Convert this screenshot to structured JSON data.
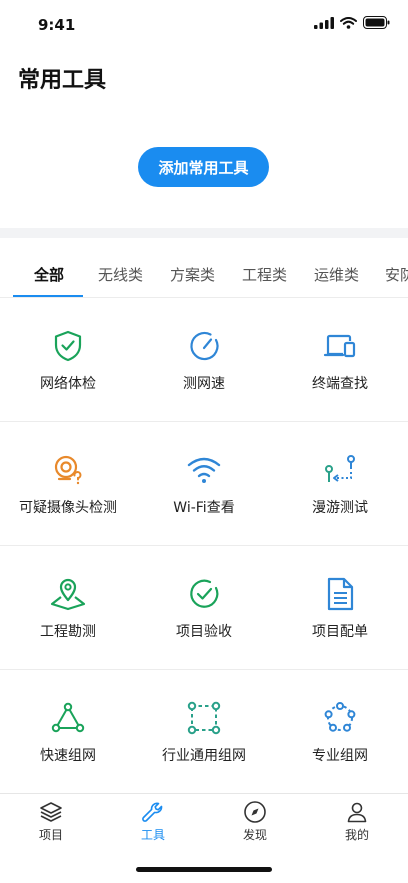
{
  "status_bar": {
    "time": "9:41"
  },
  "page": {
    "title": "常用工具"
  },
  "actions": {
    "add_label": "添加常用工具"
  },
  "tabs": [
    {
      "label": "全部",
      "active": true
    },
    {
      "label": "无线类"
    },
    {
      "label": "方案类"
    },
    {
      "label": "工程类"
    },
    {
      "label": "运维类"
    },
    {
      "label": "安防"
    }
  ],
  "tools": [
    {
      "label": "网络体检",
      "icon": "shield-check-icon"
    },
    {
      "label": "测网速",
      "icon": "speedometer-icon"
    },
    {
      "label": "终端查找",
      "icon": "devices-icon"
    },
    {
      "label": "可疑摄像头检测",
      "icon": "camera-detect-icon"
    },
    {
      "label": "Wi-Fi查看",
      "icon": "wifi-icon"
    },
    {
      "label": "漫游测试",
      "icon": "roaming-icon"
    },
    {
      "label": "工程勘测",
      "icon": "location-survey-icon"
    },
    {
      "label": "项目验收",
      "icon": "check-circle-icon"
    },
    {
      "label": "项目配单",
      "icon": "document-icon"
    },
    {
      "label": "快速组网",
      "icon": "triangle-network-icon"
    },
    {
      "label": "行业通用组网",
      "icon": "square-network-icon"
    },
    {
      "label": "专业组网",
      "icon": "ring-network-icon"
    }
  ],
  "bottom_nav": [
    {
      "label": "项目",
      "icon": "layers-icon"
    },
    {
      "label": "工具",
      "icon": "wrench-icon",
      "active": true
    },
    {
      "label": "发现",
      "icon": "compass-icon"
    },
    {
      "label": "我的",
      "icon": "user-icon"
    }
  ],
  "colors": {
    "accent": "#1a8cf0",
    "green": "#1aa35a",
    "orange": "#e8892b",
    "blue": "#2f86d6"
  }
}
